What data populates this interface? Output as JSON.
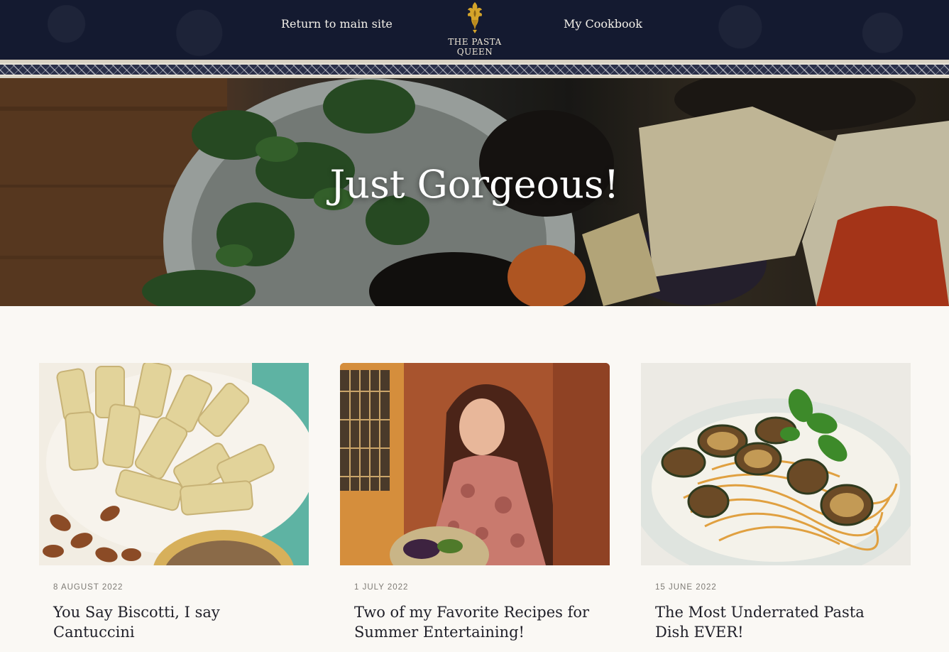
{
  "header": {
    "nav_return": "Return to main site",
    "nav_cookbook": "My Cookbook",
    "logo_text": "THE PASTA QUEEN",
    "logo_icon": "crest-icon"
  },
  "hero": {
    "title": "Just Gorgeous!"
  },
  "posts": [
    {
      "date": "8 AUGUST 2022",
      "title": "You Say Biscotti, I say Cantuccini",
      "image": "biscotti-image"
    },
    {
      "date": "1 JULY 2022",
      "title": "Two of my Favorite Recipes for Summer Entertaining!",
      "image": "portrait-image"
    },
    {
      "date": "15 JUNE 2022",
      "title": "The Most Underrated Pasta Dish EVER!",
      "image": "pasta-zucchini-image"
    }
  ],
  "colors": {
    "header_bg": "#141a30",
    "page_bg": "#faf8f4",
    "logo_gold": "#d4a42a",
    "title_text": "#1f1f28"
  }
}
